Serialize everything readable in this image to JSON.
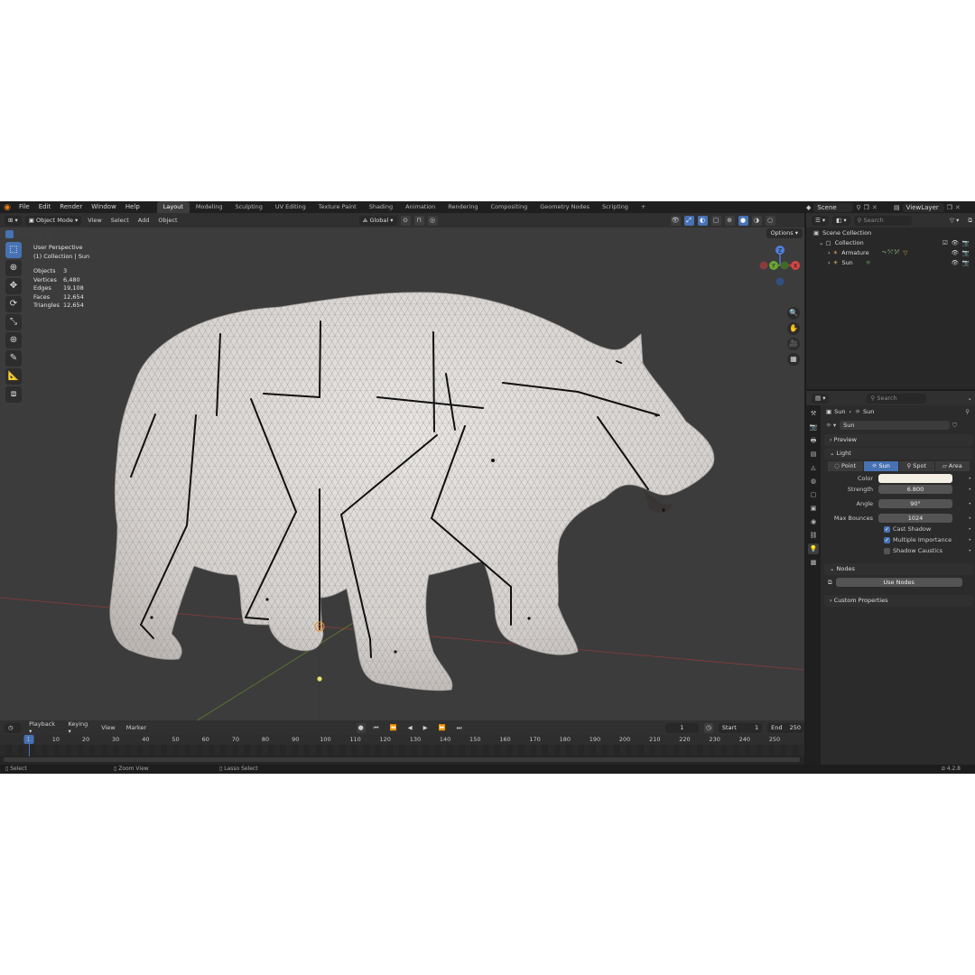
{
  "menu": [
    "File",
    "Edit",
    "Render",
    "Window",
    "Help"
  ],
  "workspaces": [
    "Layout",
    "Modeling",
    "Sculpting",
    "UV Editing",
    "Texture Paint",
    "Shading",
    "Animation",
    "Rendering",
    "Compositing",
    "Geometry Nodes",
    "Scripting"
  ],
  "workspace_add": "+",
  "scene": "Scene",
  "view_layer": "ViewLayer",
  "viewport_header": {
    "mode": "Object Mode",
    "items": [
      "View",
      "Select",
      "Add",
      "Object"
    ],
    "transform_orientation": "Global",
    "options": "Options"
  },
  "overlay": {
    "perspective": "User Perspective",
    "collection": "(1) Collection | Sun",
    "stats": [
      {
        "label": "Objects",
        "value": "3"
      },
      {
        "label": "Vertices",
        "value": "6,480"
      },
      {
        "label": "Edges",
        "value": "19,108"
      },
      {
        "label": "Faces",
        "value": "12,654"
      },
      {
        "label": "Triangles",
        "value": "12,654"
      }
    ]
  },
  "gizmo_axes": {
    "z": "Z",
    "y": "Y",
    "x": "X"
  },
  "timeline_header": {
    "items": [
      "Playback",
      "Keying",
      "View",
      "Marker"
    ],
    "current_frame": "1",
    "start_label": "Start",
    "start": "1",
    "end_label": "End",
    "end": "250"
  },
  "timeline_ticks": [
    "1",
    "10",
    "20",
    "30",
    "40",
    "50",
    "60",
    "70",
    "80",
    "90",
    "100",
    "110",
    "120",
    "130",
    "140",
    "150",
    "160",
    "170",
    "180",
    "190",
    "200",
    "210",
    "220",
    "230",
    "240",
    "250"
  ],
  "status": {
    "select": "Select",
    "zoom": "Zoom View",
    "lasso": "Lasso Select",
    "version": "4.2.8"
  },
  "outliner": {
    "search_placeholder": "Search",
    "scene_collection": "Scene Collection",
    "collection": "Collection",
    "items": [
      "Armature",
      "Sun"
    ]
  },
  "properties": {
    "search_placeholder": "Search",
    "breadcrumb": [
      "Sun",
      "Sun"
    ],
    "datablock": "Sun",
    "panels": {
      "preview": "Preview",
      "light": "Light",
      "nodes": "Nodes",
      "custom": "Custom Properties"
    },
    "light_types": [
      "Point",
      "Sun",
      "Spot",
      "Area"
    ],
    "active_type": "Sun",
    "color_label": "Color",
    "color_value": "#f4efe4",
    "strength_label": "Strength",
    "strength": "6.800",
    "angle_label": "Angle",
    "angle": "90°",
    "max_bounces_label": "Max Bounces",
    "max_bounces": "1024",
    "cast_shadow": "Cast Shadow",
    "multiple_importance": "Multiple Importance",
    "shadow_caustics": "Shadow Caustics",
    "use_nodes": "Use Nodes"
  }
}
